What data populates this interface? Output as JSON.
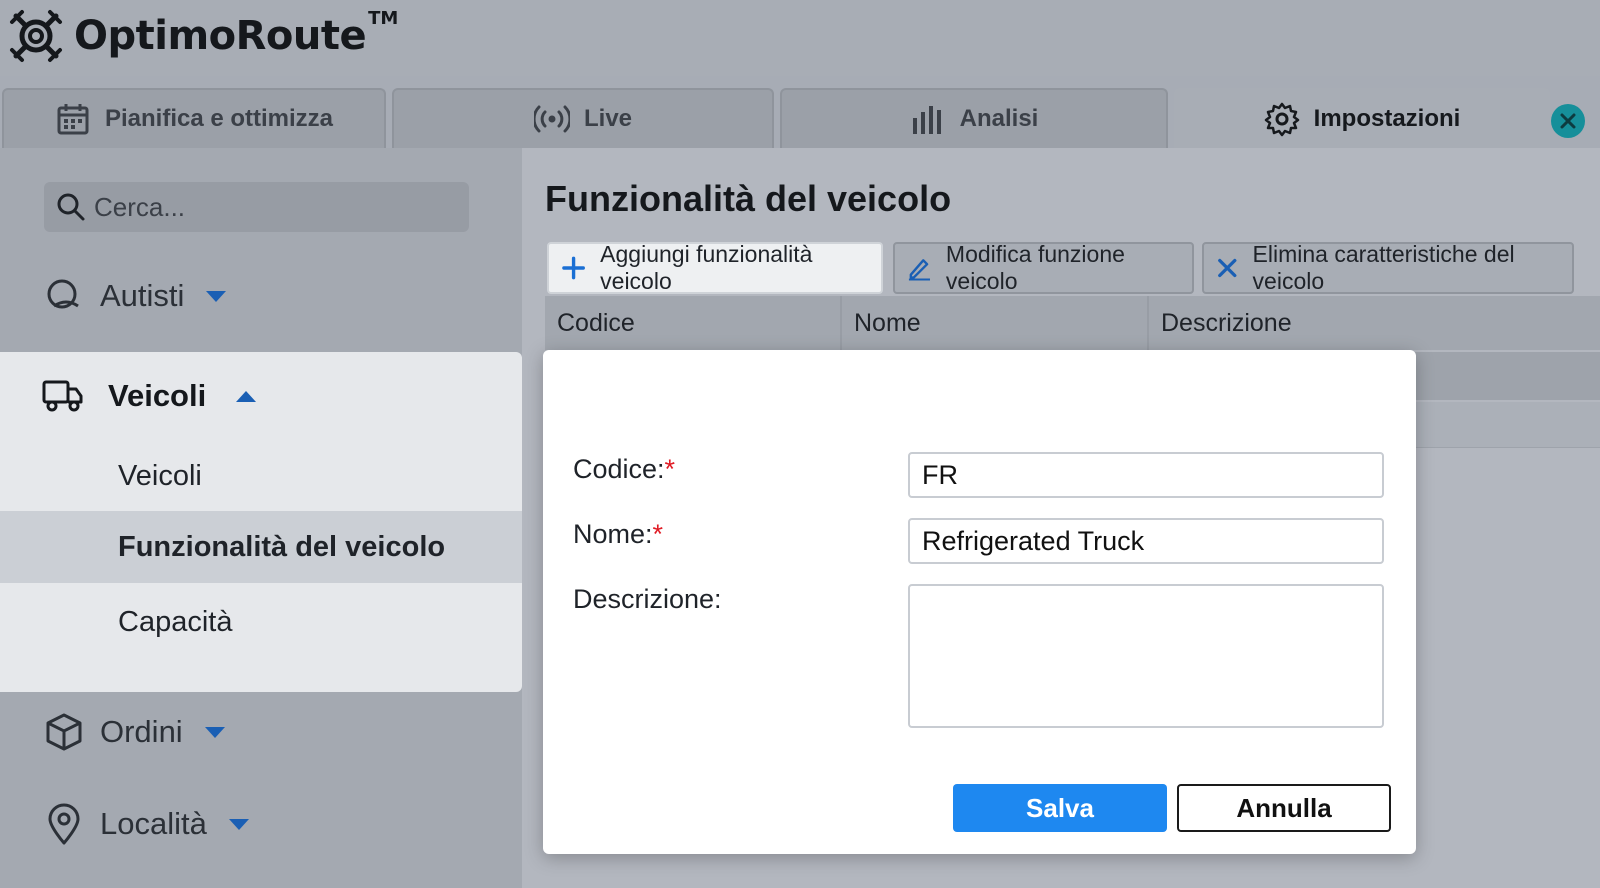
{
  "app": {
    "name": "OptimoRoute",
    "trademark": "TM"
  },
  "tabs": [
    {
      "label": "Pianifica e ottimizza",
      "icon": "calendar-icon"
    },
    {
      "label": "Live",
      "icon": "broadcast-icon"
    },
    {
      "label": "Analisi",
      "icon": "bar-chart-icon"
    },
    {
      "label": "Impostazioni",
      "icon": "gear-icon",
      "active": true
    }
  ],
  "sidebar": {
    "search_placeholder": "Cerca...",
    "groups": [
      {
        "label": "Autisti",
        "icon": "driver-icon",
        "expanded": false
      },
      {
        "label": "Veicoli",
        "icon": "truck-icon",
        "expanded": true
      },
      {
        "label": "Ordini",
        "icon": "package-icon",
        "expanded": false
      },
      {
        "label": "Località",
        "icon": "location-pin-icon",
        "expanded": false
      }
    ],
    "veicoli_items": [
      {
        "label": "Veicoli"
      },
      {
        "label": "Funzionalità del veicolo",
        "selected": true
      },
      {
        "label": "Capacità"
      }
    ]
  },
  "main": {
    "title": "Funzionalità del veicolo",
    "toolbar": {
      "add": "Aggiungi funzionalità veicolo",
      "edit": "Modifica funzione veicolo",
      "delete": "Elimina caratteristiche del veicolo"
    },
    "table_columns": [
      "Codice",
      "Nome",
      "Descrizione"
    ]
  },
  "dialog": {
    "code_label": "Codice:",
    "name_label": "Nome:",
    "description_label": "Descrizione:",
    "required_mark": "*",
    "code_value": "FR",
    "name_value": "Refrigerated Truck",
    "description_value": "",
    "save": "Salva",
    "cancel": "Annulla"
  },
  "colors": {
    "accent": "#1e88f0",
    "required": "#e01b24",
    "close": "#168f9a"
  }
}
